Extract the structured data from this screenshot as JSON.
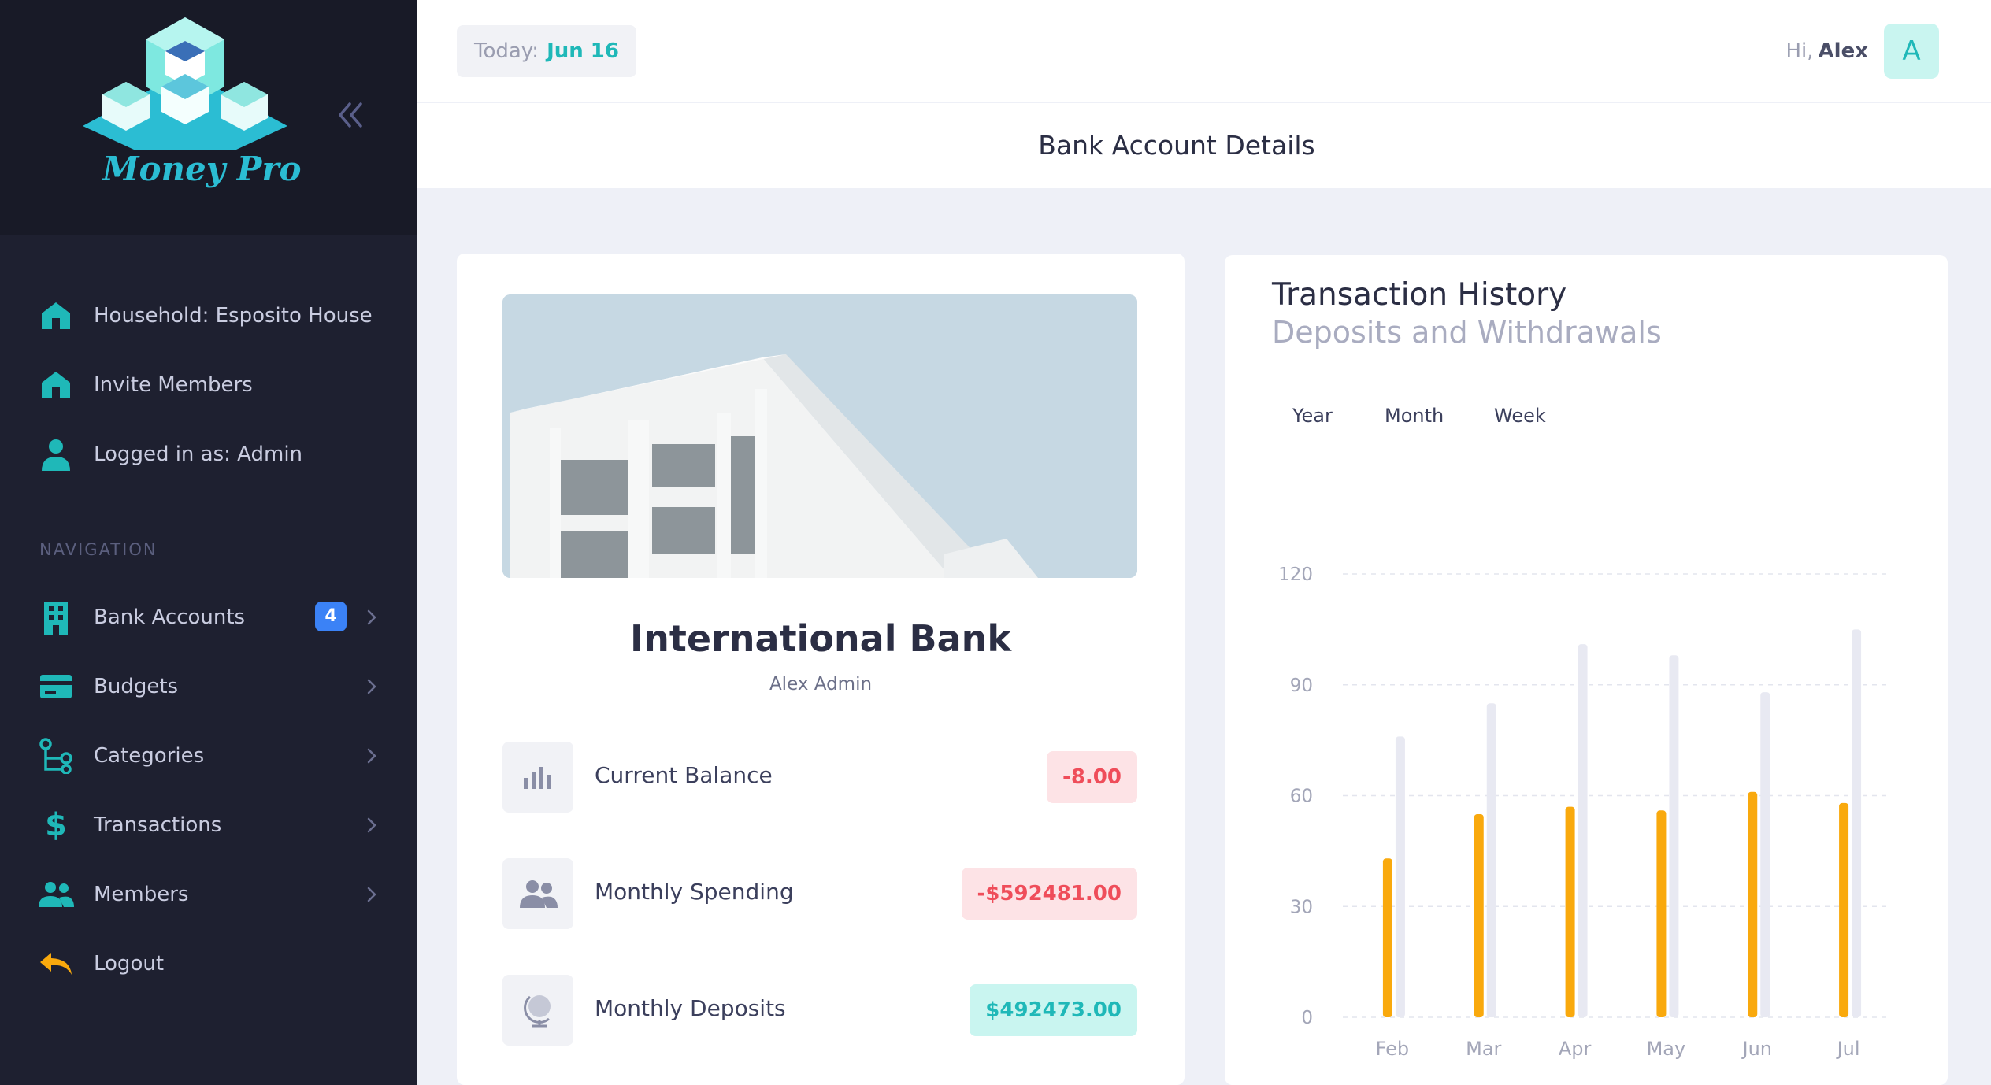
{
  "app": {
    "name": "Money Pro"
  },
  "topbar": {
    "today_label": "Today:",
    "today_value": "Jun 16",
    "greeting": "Hi,",
    "user": "Alex",
    "avatar_letter": "A"
  },
  "page_title": "Bank Account Details",
  "sidebar": {
    "top_items": [
      {
        "label": "Household: Esposito House",
        "icon": "home-icon"
      },
      {
        "label": "Invite Members",
        "icon": "home-icon"
      },
      {
        "label": "Logged in as: Admin",
        "icon": "user-icon"
      }
    ],
    "nav_heading": "NAVIGATION",
    "nav_items": [
      {
        "label": "Bank Accounts",
        "icon": "building-icon",
        "badge": "4"
      },
      {
        "label": "Budgets",
        "icon": "card-icon"
      },
      {
        "label": "Categories",
        "icon": "hierarchy-icon"
      },
      {
        "label": "Transactions",
        "icon": "dollar-icon"
      },
      {
        "label": "Members",
        "icon": "users-icon"
      },
      {
        "label": "Logout",
        "icon": "logout-icon"
      }
    ]
  },
  "account": {
    "bank_name": "International Bank",
    "owner": "Alex Admin",
    "stats": [
      {
        "label": "Current Balance",
        "value": "-8.00",
        "icon": "bar-chart-icon",
        "status": "negative"
      },
      {
        "label": "Monthly Spending",
        "value": "-$592481.00",
        "icon": "users-icon",
        "status": "negative"
      },
      {
        "label": "Monthly Deposits",
        "value": "$492473.00",
        "icon": "globe-icon",
        "status": "positive"
      }
    ]
  },
  "history": {
    "title": "Transaction History",
    "subtitle": "Deposits and Withdrawals",
    "tabs": [
      "Year",
      "Month",
      "Week"
    ]
  },
  "colors": {
    "accent": "#1fb8b8",
    "deposit_bar": "#f9a90d",
    "withdraw_bar": "#e8e9f2",
    "negative": "#ef4d5a",
    "sidebar_bg": "#1e2030"
  },
  "chart_data": {
    "type": "bar",
    "categories": [
      "Feb",
      "Mar",
      "Apr",
      "May",
      "Jun",
      "Jul"
    ],
    "series": [
      {
        "values": [
          43,
          55,
          57,
          56,
          61,
          58
        ]
      },
      {
        "values": [
          76,
          85,
          101,
          98,
          88,
          105
        ]
      }
    ],
    "ylim": [
      0,
      120
    ],
    "yticks": [
      0,
      30,
      60,
      90,
      120
    ],
    "grid": true
  }
}
